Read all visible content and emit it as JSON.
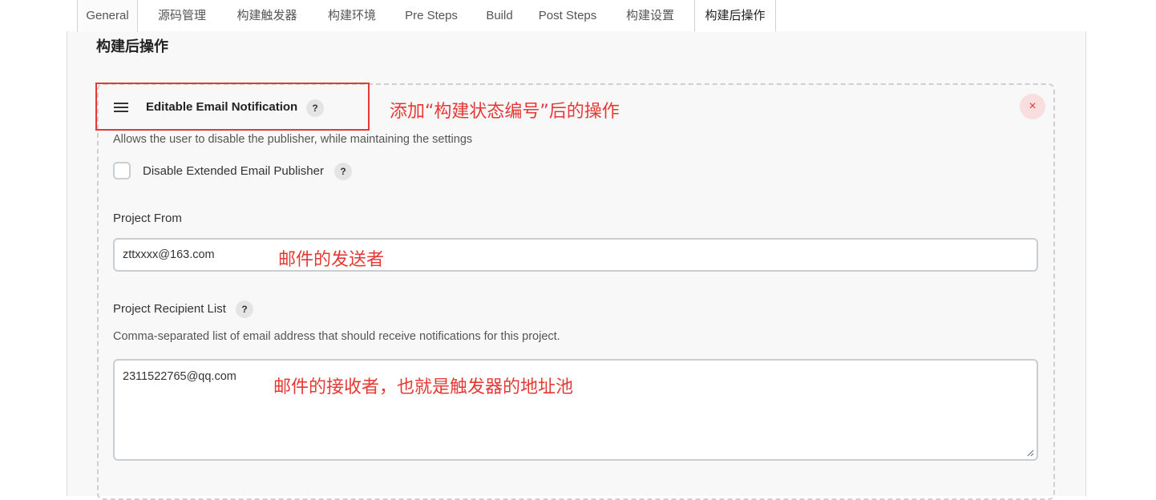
{
  "tabs": [
    "General",
    "源码管理",
    "构建触发器",
    "构建环境",
    "Pre Steps",
    "Build",
    "Post Steps",
    "构建设置",
    "构建后操作"
  ],
  "active_tab": "构建后操作",
  "section": {
    "title": "构建后操作"
  },
  "card": {
    "title": "Editable Email Notification",
    "help": "?",
    "description": "Allows the user to disable the publisher, while maintaining the settings",
    "close": "×"
  },
  "disable_publisher": {
    "label": "Disable Extended Email Publisher",
    "help": "?",
    "checked": false
  },
  "project_from": {
    "label": "Project From",
    "value": "zttxxxx@163.com"
  },
  "recipient_list": {
    "label": "Project Recipient List",
    "help": "?",
    "description": "Comma-separated list of email address that should receive notifications for this project.",
    "value": "2311522765@qq.com"
  },
  "annotations": {
    "card": "添加“构建状态编号”后的操作",
    "sender": "邮件的发送者",
    "recipients": "邮件的接收者，也就是触发器的地址池"
  },
  "colors": {
    "annotation": "#e53935",
    "panel": "#f8f8f8"
  }
}
